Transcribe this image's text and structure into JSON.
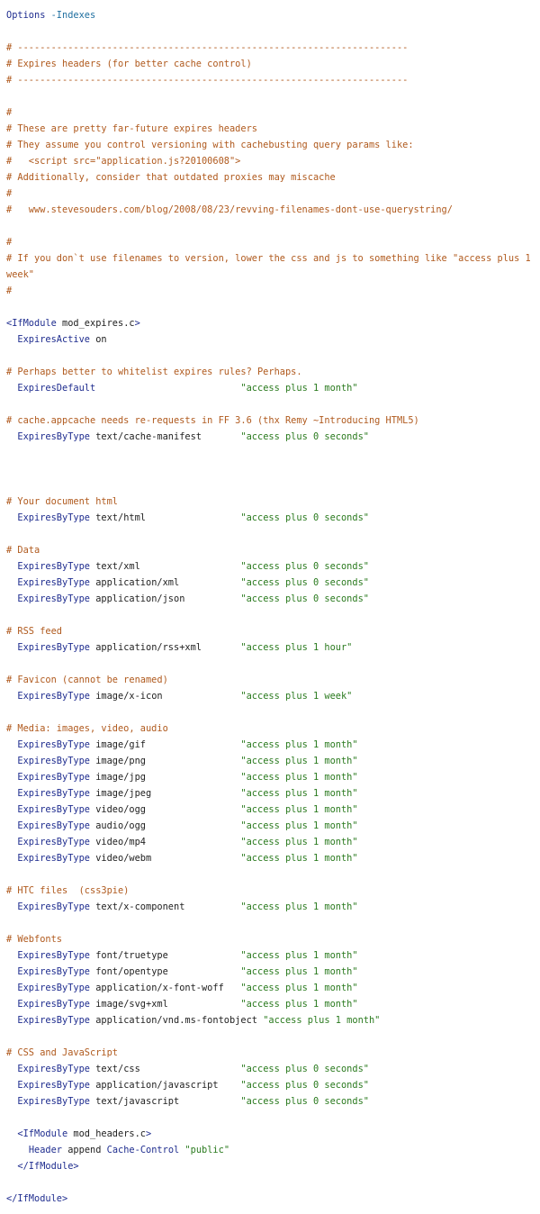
{
  "lines": [
    [
      {
        "t": "Options ",
        "c": "keyword"
      },
      {
        "t": "-Indexes",
        "c": "flag"
      }
    ],
    [],
    [
      {
        "t": "# ----------------------------------------------------------------------",
        "c": "comment"
      }
    ],
    [
      {
        "t": "# Expires headers (for better cache control)",
        "c": "comment"
      }
    ],
    [
      {
        "t": "# ----------------------------------------------------------------------",
        "c": "comment"
      }
    ],
    [],
    [
      {
        "t": "#",
        "c": "comment"
      }
    ],
    [
      {
        "t": "# These are pretty far-future expires headers",
        "c": "comment"
      }
    ],
    [
      {
        "t": "# They assume you control versioning with cachebusting query params like:",
        "c": "comment"
      }
    ],
    [
      {
        "t": "#   <script src=\"application.js?20100608\">",
        "c": "comment"
      }
    ],
    [
      {
        "t": "# Additionally, consider that outdated proxies may miscache",
        "c": "comment"
      }
    ],
    [
      {
        "t": "#",
        "c": "comment"
      }
    ],
    [
      {
        "t": "#   www.stevesouders.com/blog/2008/08/23/revving-filenames-dont-use-querystring/",
        "c": "comment"
      }
    ],
    [],
    [
      {
        "t": "#",
        "c": "comment"
      }
    ],
    [
      {
        "t": "# If you don`t use filenames to version, lower the css and js to something like \"access plus 1",
        "c": "comment"
      }
    ],
    [
      {
        "t": "week\"",
        "c": "comment"
      }
    ],
    [
      {
        "t": "#",
        "c": "comment"
      }
    ],
    [],
    [
      {
        "t": "<IfModule ",
        "c": "keyword"
      },
      {
        "t": "mod_expires.c",
        "c": "plain"
      },
      {
        "t": ">",
        "c": "keyword"
      }
    ],
    [
      {
        "t": "  ",
        "c": "plain"
      },
      {
        "t": "ExpiresActive",
        "c": "keyword"
      },
      {
        "t": " on",
        "c": "plain"
      }
    ],
    [],
    [
      {
        "t": "# Perhaps better to whitelist expires rules? Perhaps.",
        "c": "comment"
      }
    ],
    [
      {
        "t": "  ",
        "c": "plain"
      },
      {
        "t": "ExpiresDefault",
        "c": "keyword"
      },
      {
        "t": "                          ",
        "c": "plain"
      },
      {
        "t": "\"access plus 1 month\"",
        "c": "string"
      }
    ],
    [],
    [
      {
        "t": "# cache.appcache needs re-requests in FF 3.6 (thx Remy ~Introducing HTML5)",
        "c": "comment"
      }
    ],
    [
      {
        "t": "  ",
        "c": "plain"
      },
      {
        "t": "ExpiresByType",
        "c": "keyword"
      },
      {
        "t": " text/cache-manifest       ",
        "c": "plain"
      },
      {
        "t": "\"access plus 0 seconds\"",
        "c": "string"
      }
    ],
    [],
    [],
    [],
    [
      {
        "t": "# Your document html",
        "c": "comment"
      }
    ],
    [
      {
        "t": "  ",
        "c": "plain"
      },
      {
        "t": "ExpiresByType",
        "c": "keyword"
      },
      {
        "t": " text/html                 ",
        "c": "plain"
      },
      {
        "t": "\"access plus 0 seconds\"",
        "c": "string"
      }
    ],
    [],
    [
      {
        "t": "# Data",
        "c": "comment"
      }
    ],
    [
      {
        "t": "  ",
        "c": "plain"
      },
      {
        "t": "ExpiresByType",
        "c": "keyword"
      },
      {
        "t": " text/xml                  ",
        "c": "plain"
      },
      {
        "t": "\"access plus 0 seconds\"",
        "c": "string"
      }
    ],
    [
      {
        "t": "  ",
        "c": "plain"
      },
      {
        "t": "ExpiresByType",
        "c": "keyword"
      },
      {
        "t": " application/xml           ",
        "c": "plain"
      },
      {
        "t": "\"access plus 0 seconds\"",
        "c": "string"
      }
    ],
    [
      {
        "t": "  ",
        "c": "plain"
      },
      {
        "t": "ExpiresByType",
        "c": "keyword"
      },
      {
        "t": " application/json          ",
        "c": "plain"
      },
      {
        "t": "\"access plus 0 seconds\"",
        "c": "string"
      }
    ],
    [],
    [
      {
        "t": "# RSS feed",
        "c": "comment"
      }
    ],
    [
      {
        "t": "  ",
        "c": "plain"
      },
      {
        "t": "ExpiresByType",
        "c": "keyword"
      },
      {
        "t": " application/rss+xml       ",
        "c": "plain"
      },
      {
        "t": "\"access plus 1 hour\"",
        "c": "string"
      }
    ],
    [],
    [
      {
        "t": "# Favicon (cannot be renamed)",
        "c": "comment"
      }
    ],
    [
      {
        "t": "  ",
        "c": "plain"
      },
      {
        "t": "ExpiresByType",
        "c": "keyword"
      },
      {
        "t": " image/x-icon              ",
        "c": "plain"
      },
      {
        "t": "\"access plus 1 week\"",
        "c": "string"
      }
    ],
    [],
    [
      {
        "t": "# Media: images, video, audio",
        "c": "comment"
      }
    ],
    [
      {
        "t": "  ",
        "c": "plain"
      },
      {
        "t": "ExpiresByType",
        "c": "keyword"
      },
      {
        "t": " image/gif                 ",
        "c": "plain"
      },
      {
        "t": "\"access plus 1 month\"",
        "c": "string"
      }
    ],
    [
      {
        "t": "  ",
        "c": "plain"
      },
      {
        "t": "ExpiresByType",
        "c": "keyword"
      },
      {
        "t": " image/png                 ",
        "c": "plain"
      },
      {
        "t": "\"access plus 1 month\"",
        "c": "string"
      }
    ],
    [
      {
        "t": "  ",
        "c": "plain"
      },
      {
        "t": "ExpiresByType",
        "c": "keyword"
      },
      {
        "t": " image/jpg                 ",
        "c": "plain"
      },
      {
        "t": "\"access plus 1 month\"",
        "c": "string"
      }
    ],
    [
      {
        "t": "  ",
        "c": "plain"
      },
      {
        "t": "ExpiresByType",
        "c": "keyword"
      },
      {
        "t": " image/jpeg                ",
        "c": "plain"
      },
      {
        "t": "\"access plus 1 month\"",
        "c": "string"
      }
    ],
    [
      {
        "t": "  ",
        "c": "plain"
      },
      {
        "t": "ExpiresByType",
        "c": "keyword"
      },
      {
        "t": " video/ogg                 ",
        "c": "plain"
      },
      {
        "t": "\"access plus 1 month\"",
        "c": "string"
      }
    ],
    [
      {
        "t": "  ",
        "c": "plain"
      },
      {
        "t": "ExpiresByType",
        "c": "keyword"
      },
      {
        "t": " audio/ogg                 ",
        "c": "plain"
      },
      {
        "t": "\"access plus 1 month\"",
        "c": "string"
      }
    ],
    [
      {
        "t": "  ",
        "c": "plain"
      },
      {
        "t": "ExpiresByType",
        "c": "keyword"
      },
      {
        "t": " video/mp4                 ",
        "c": "plain"
      },
      {
        "t": "\"access plus 1 month\"",
        "c": "string"
      }
    ],
    [
      {
        "t": "  ",
        "c": "plain"
      },
      {
        "t": "ExpiresByType",
        "c": "keyword"
      },
      {
        "t": " video/webm                ",
        "c": "plain"
      },
      {
        "t": "\"access plus 1 month\"",
        "c": "string"
      }
    ],
    [],
    [
      {
        "t": "# HTC files  (css3pie)",
        "c": "comment"
      }
    ],
    [
      {
        "t": "  ",
        "c": "plain"
      },
      {
        "t": "ExpiresByType",
        "c": "keyword"
      },
      {
        "t": " text/x-component          ",
        "c": "plain"
      },
      {
        "t": "\"access plus 1 month\"",
        "c": "string"
      }
    ],
    [],
    [
      {
        "t": "# Webfonts",
        "c": "comment"
      }
    ],
    [
      {
        "t": "  ",
        "c": "plain"
      },
      {
        "t": "ExpiresByType",
        "c": "keyword"
      },
      {
        "t": " font/truetype             ",
        "c": "plain"
      },
      {
        "t": "\"access plus 1 month\"",
        "c": "string"
      }
    ],
    [
      {
        "t": "  ",
        "c": "plain"
      },
      {
        "t": "ExpiresByType",
        "c": "keyword"
      },
      {
        "t": " font/opentype             ",
        "c": "plain"
      },
      {
        "t": "\"access plus 1 month\"",
        "c": "string"
      }
    ],
    [
      {
        "t": "  ",
        "c": "plain"
      },
      {
        "t": "ExpiresByType",
        "c": "keyword"
      },
      {
        "t": " application/x-font-woff   ",
        "c": "plain"
      },
      {
        "t": "\"access plus 1 month\"",
        "c": "string"
      }
    ],
    [
      {
        "t": "  ",
        "c": "plain"
      },
      {
        "t": "ExpiresByType",
        "c": "keyword"
      },
      {
        "t": " image/svg+xml             ",
        "c": "plain"
      },
      {
        "t": "\"access plus 1 month\"",
        "c": "string"
      }
    ],
    [
      {
        "t": "  ",
        "c": "plain"
      },
      {
        "t": "ExpiresByType",
        "c": "keyword"
      },
      {
        "t": " application/vnd.ms-fontobject ",
        "c": "plain"
      },
      {
        "t": "\"access plus 1 month\"",
        "c": "string"
      }
    ],
    [],
    [
      {
        "t": "# CSS and JavaScript",
        "c": "comment"
      }
    ],
    [
      {
        "t": "  ",
        "c": "plain"
      },
      {
        "t": "ExpiresByType",
        "c": "keyword"
      },
      {
        "t": " text/css                  ",
        "c": "plain"
      },
      {
        "t": "\"access plus 0 seconds\"",
        "c": "string"
      }
    ],
    [
      {
        "t": "  ",
        "c": "plain"
      },
      {
        "t": "ExpiresByType",
        "c": "keyword"
      },
      {
        "t": " application/javascript    ",
        "c": "plain"
      },
      {
        "t": "\"access plus 0 seconds\"",
        "c": "string"
      }
    ],
    [
      {
        "t": "  ",
        "c": "plain"
      },
      {
        "t": "ExpiresByType",
        "c": "keyword"
      },
      {
        "t": " text/javascript           ",
        "c": "plain"
      },
      {
        "t": "\"access plus 0 seconds\"",
        "c": "string"
      }
    ],
    [],
    [
      {
        "t": "  ",
        "c": "plain"
      },
      {
        "t": "<IfModule ",
        "c": "keyword"
      },
      {
        "t": "mod_headers.c",
        "c": "plain"
      },
      {
        "t": ">",
        "c": "keyword"
      }
    ],
    [
      {
        "t": "    ",
        "c": "plain"
      },
      {
        "t": "Header",
        "c": "keyword"
      },
      {
        "t": " append ",
        "c": "plain"
      },
      {
        "t": "Cache-Control",
        "c": "keyword"
      },
      {
        "t": " ",
        "c": "plain"
      },
      {
        "t": "\"public\"",
        "c": "string"
      }
    ],
    [
      {
        "t": "  ",
        "c": "plain"
      },
      {
        "t": "</IfModule>",
        "c": "keyword"
      }
    ],
    [],
    [
      {
        "t": "</IfModule>",
        "c": "keyword"
      }
    ]
  ]
}
